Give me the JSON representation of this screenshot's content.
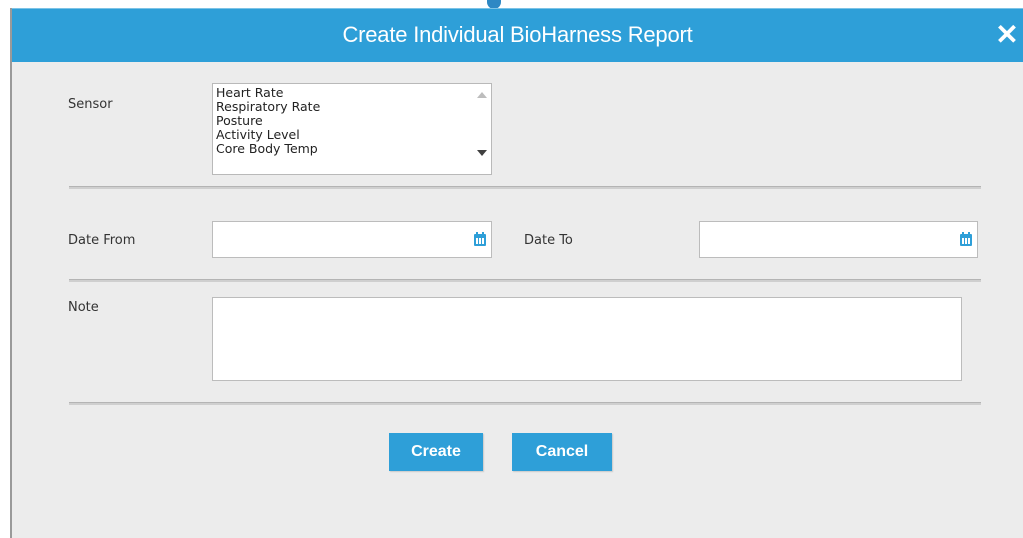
{
  "dialog": {
    "title": "Create Individual BioHarness Report",
    "close_label": "✕"
  },
  "form": {
    "sensor_label": "Sensor",
    "sensor_options": [
      "Heart Rate",
      "Respiratory Rate",
      "Posture",
      "Activity Level",
      "Core Body Temp"
    ],
    "date_from_label": "Date From",
    "date_from_value": "",
    "date_to_label": "Date To",
    "date_to_value": "",
    "note_label": "Note",
    "note_value": ""
  },
  "buttons": {
    "create_label": "Create",
    "cancel_label": "Cancel"
  },
  "colors": {
    "accent": "#2e9fd8",
    "dialog_bg": "#ececec"
  },
  "icons": {
    "close": "close-icon",
    "calendar": "calendar-icon",
    "scroll_up": "scroll-up-icon",
    "scroll_down": "scroll-down-icon"
  }
}
